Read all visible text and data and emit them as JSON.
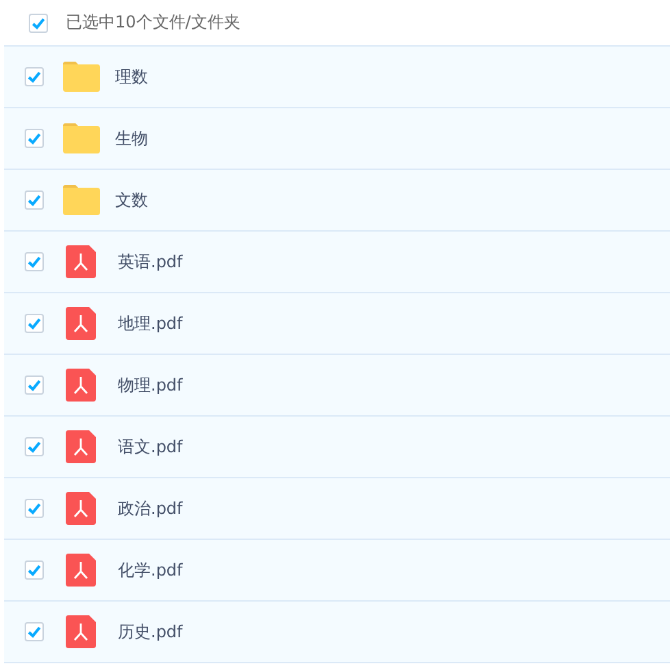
{
  "header": {
    "checked": true,
    "label": "已选中10个文件/文件夹"
  },
  "files": [
    {
      "kind": "folder",
      "name": "理数",
      "checked": true
    },
    {
      "kind": "folder",
      "name": "生物",
      "checked": true
    },
    {
      "kind": "folder",
      "name": "文数",
      "checked": true
    },
    {
      "kind": "pdf",
      "name": "英语.pdf",
      "checked": true
    },
    {
      "kind": "pdf",
      "name": "地理.pdf",
      "checked": true
    },
    {
      "kind": "pdf",
      "name": "物理.pdf",
      "checked": true
    },
    {
      "kind": "pdf",
      "name": "语文.pdf",
      "checked": true
    },
    {
      "kind": "pdf",
      "name": "政治.pdf",
      "checked": true
    },
    {
      "kind": "pdf",
      "name": "化学.pdf",
      "checked": true
    },
    {
      "kind": "pdf",
      "name": "历史.pdf",
      "checked": true
    }
  ]
}
